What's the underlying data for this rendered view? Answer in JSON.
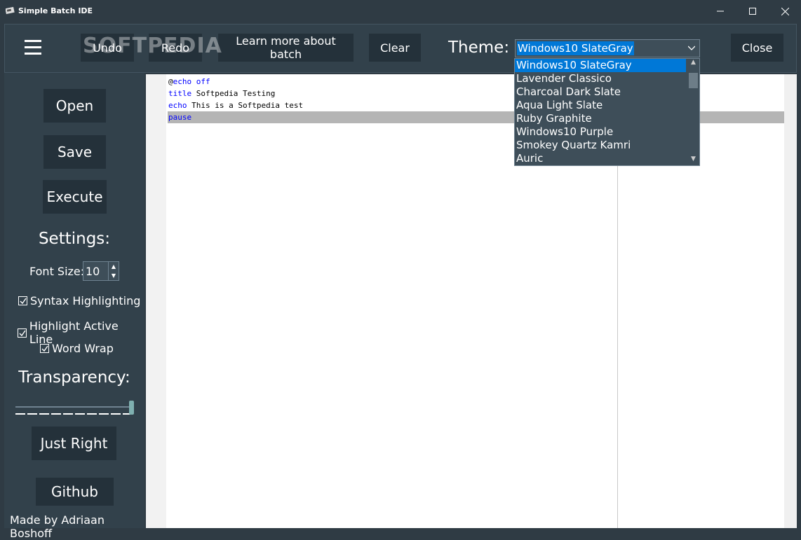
{
  "window": {
    "title": "Simple Batch IDE"
  },
  "toolbar": {
    "undo_label": "Undo",
    "redo_label": "Redo",
    "learn_label": "Learn more about batch",
    "clear_label": "Clear",
    "theme_label": "Theme:",
    "close_label": "Close"
  },
  "theme": {
    "selected": "Windows10 SlateGray",
    "options": [
      "Windows10 SlateGray",
      "Lavender Classico",
      "Charcoal Dark Slate",
      "Aqua Light Slate",
      "Ruby Graphite",
      "Windows10 Purple",
      "Smokey Quartz Kamri",
      "Auric"
    ]
  },
  "sidebar": {
    "open_label": "Open",
    "save_label": "Save",
    "execute_label": "Execute",
    "settings_heading": "Settings:",
    "font_size_label": "Font Size:",
    "font_size_value": "10",
    "syntax_label": "Syntax Highlighting",
    "syntax_checked": true,
    "highlight_label": "Highlight Active Line",
    "highlight_checked": true,
    "wordwrap_label": "Word Wrap",
    "wordwrap_checked": true,
    "transparency_heading": "Transparency:",
    "transparency_level": 1.0,
    "just_right_label": "Just Right",
    "github_label": "Github",
    "made_by": "Made by Adriaan Boshoff"
  },
  "editor": {
    "lines": [
      {
        "kw": "echo off",
        "prefix": "@",
        "rest": ""
      },
      {
        "kw": "title",
        "prefix": "",
        "rest": " Softpedia Testing"
      },
      {
        "kw": "echo",
        "prefix": "",
        "rest": " This is a Softpedia test"
      },
      {
        "kw": "pause",
        "prefix": "",
        "rest": ""
      }
    ],
    "active_line": 3
  },
  "watermark": "SOFTPEDIA",
  "colors": {
    "accent": "#0078d7",
    "background": "#2f3b44",
    "button": "#24313a",
    "keyword": "#0000ff"
  }
}
